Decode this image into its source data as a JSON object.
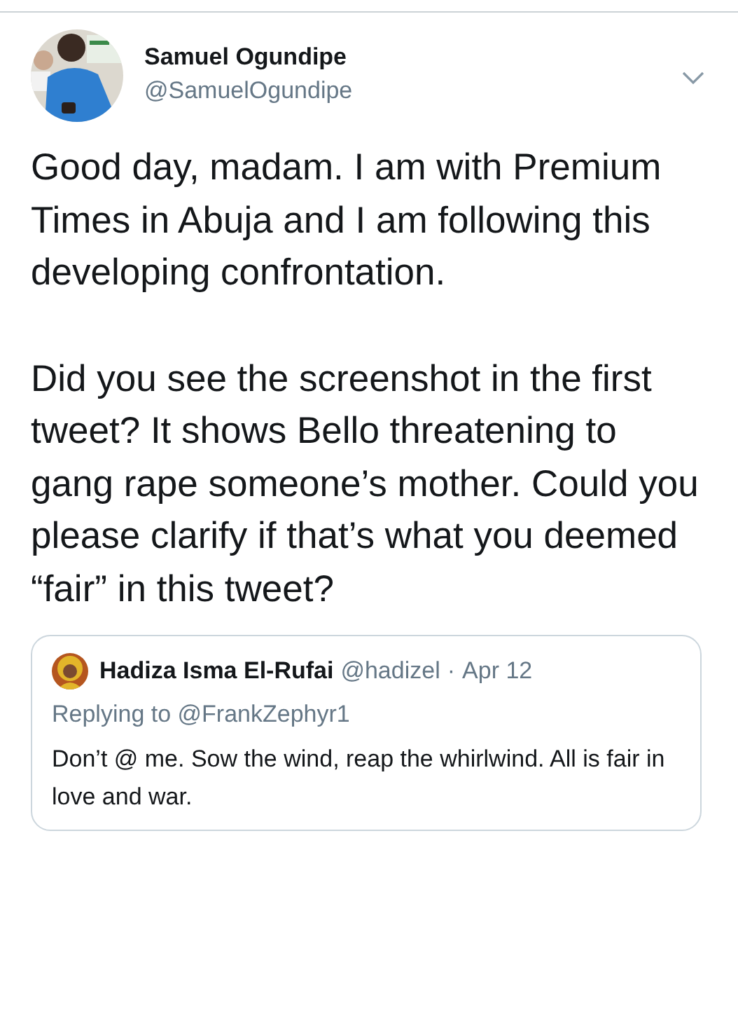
{
  "author": {
    "name": "Samuel Ogundipe",
    "handle": "@SamuelOgundipe"
  },
  "tweet": {
    "paragraphs": [
      "Good day, madam. I am with Premium Times in Abuja and I am following this developing confrontation.",
      "Did you see the screenshot in the first tweet? It shows Bello threatening to gang rape someone’s mother. Could you please clarify if that’s what you deemed “fair” in this tweet?"
    ]
  },
  "quoted_tweet": {
    "name": "Hadiza Isma El-Rufai",
    "handle": "@hadizel",
    "separator": "·",
    "date": "Apr 12",
    "replying_to": "Replying to @FrankZephyr1",
    "text": "Don’t @ me. Sow the wind, reap the whirlwind. All is fair in love and war."
  }
}
